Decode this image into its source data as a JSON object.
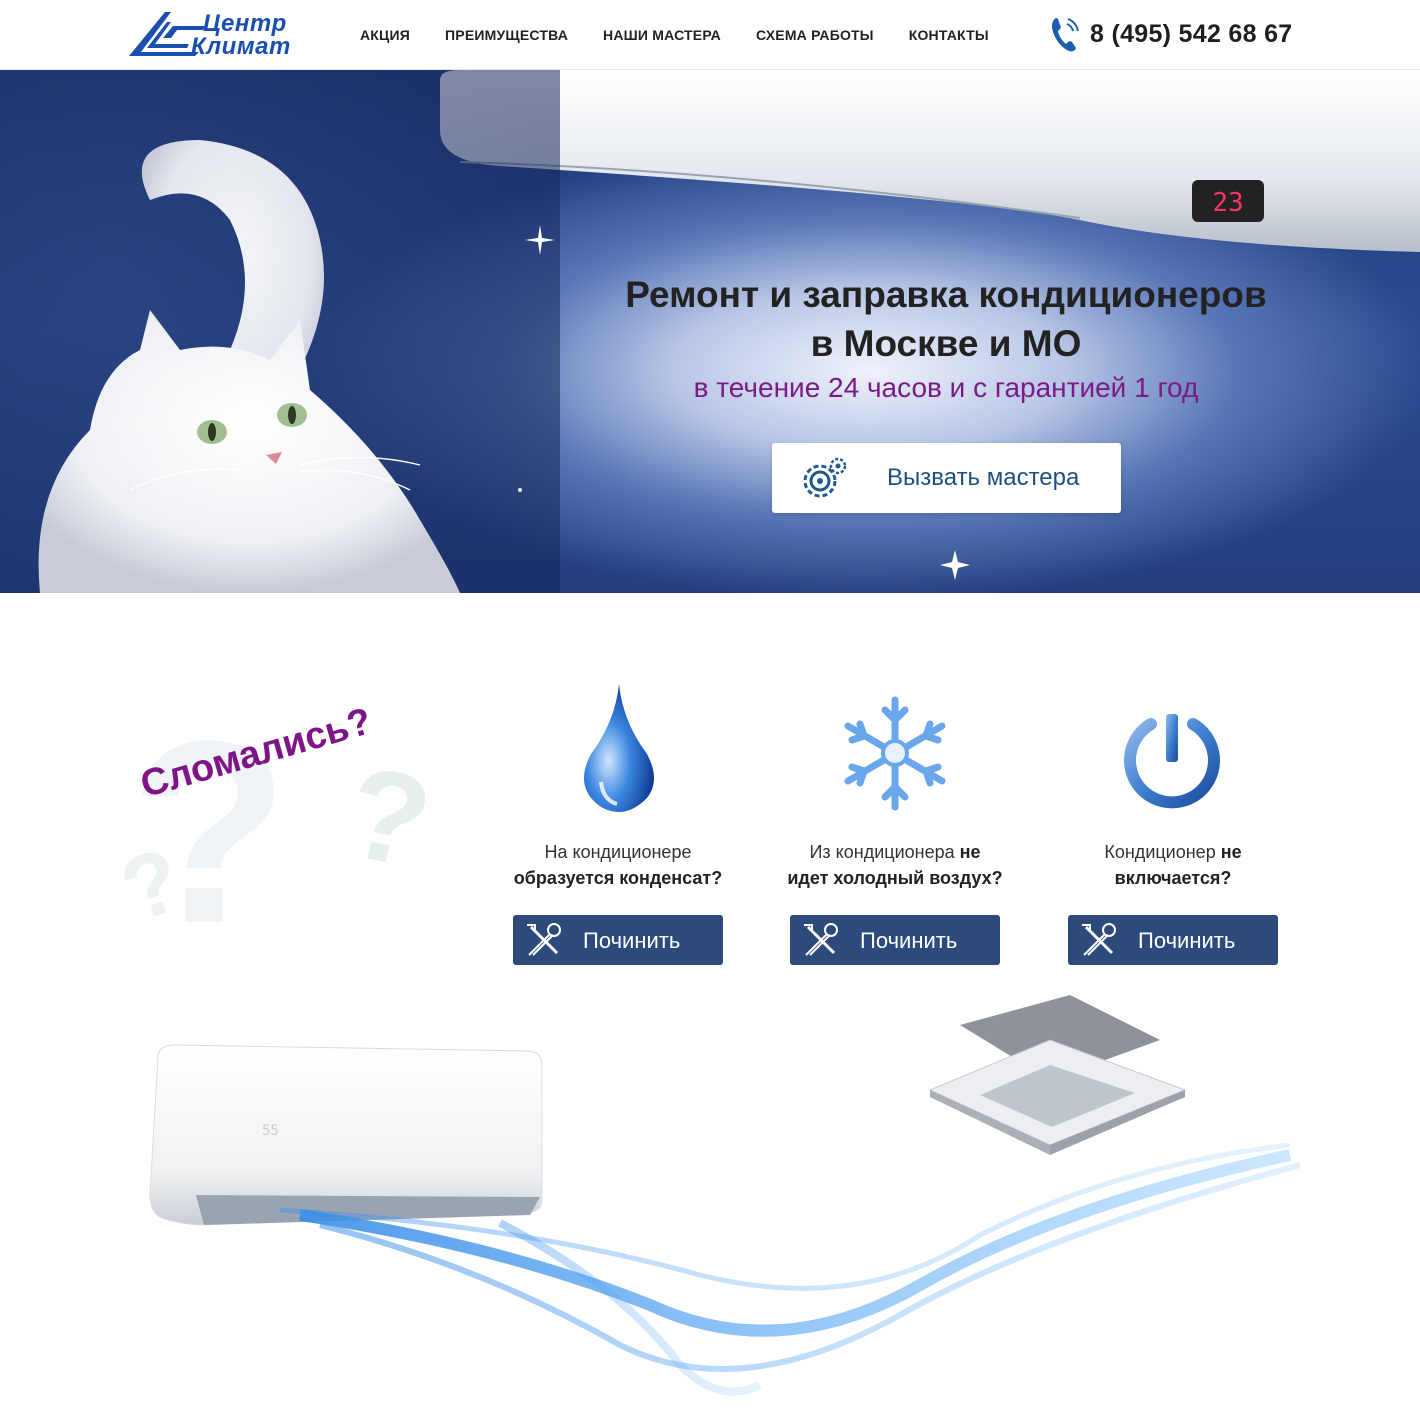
{
  "header": {
    "logo_line1": "Центр",
    "logo_line2": "Климат",
    "nav": [
      "АКЦИЯ",
      "ПРЕИМУЩЕСТВА",
      "НАШИ МАСТЕРА",
      "СХЕМА РАБОТЫ",
      "КОНТАКТЫ"
    ],
    "phone": "8 (495) 542 68 67",
    "phone_icon": "phone-icon"
  },
  "hero": {
    "title_line1": "Ремонт и заправка кондиционеров",
    "title_line2": "в Москве и МО",
    "subtitle": "в течение 24 часов и с гарантией 1 год",
    "cta_label": "Вызвать мастера",
    "cta_icon": "gears-icon",
    "ac_display": "23"
  },
  "problems": {
    "heading": "Сломались?",
    "items": [
      {
        "icon": "water-drop-icon",
        "text_normal": "На кондиционере",
        "text_bold": "образуется конденсат?",
        "button": "Починить"
      },
      {
        "icon": "snowflake-icon",
        "text_normal": "Из кондиционера",
        "text_bold_inline": "не",
        "text_bold": "идет холодный воздух?",
        "button": "Починить"
      },
      {
        "icon": "power-icon",
        "text_normal": "Кондиционер",
        "text_bold_inline": "не",
        "text_bold": "включается?",
        "button": "Починить"
      }
    ]
  },
  "colors": {
    "brand_blue": "#1a4fb0",
    "button_navy": "#2d4a7c",
    "accent_purple": "#7d1587",
    "cta_text": "#1e4f80"
  }
}
